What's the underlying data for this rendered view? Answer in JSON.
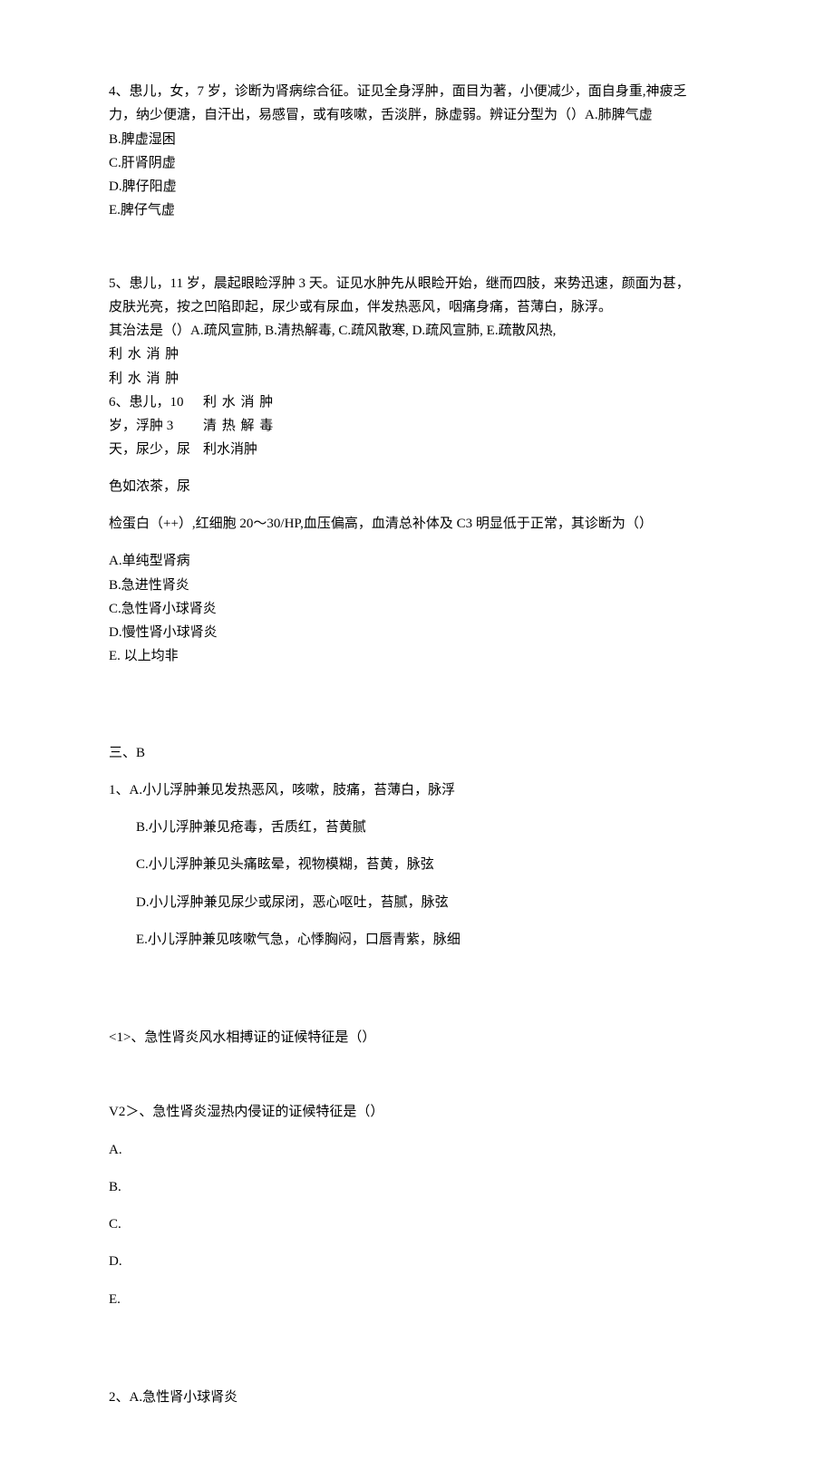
{
  "q4": {
    "stem_line1": "4、患儿，女，7 岁，诊断为肾病综合征。证见全身浮肿，面目为著，小便减少，面自身重,神疲乏",
    "stem_line2": "力，纳少便溏，自汗出，易感冒，或有咳嗽，舌淡胖，脉虚弱。辨证分型为（）A.肺脾气虚",
    "optB": "B.脾虚湿困",
    "optC": "C.肝肾阴虚",
    "optD": "D.脾仔阳虚",
    "optE": "E.脾仔气虚"
  },
  "q5": {
    "stem_line1": "5、患儿，11 岁，晨起眼睑浮肿 3 天。证见水肿先从眼睑开始，继而四肢，来势迅速，颜面为甚，",
    "stem_line2": "皮肤光亮，按之凹陷即起，尿少或有尿血，伴发热恶风，咽痛身痛，苔薄白，脉浮。",
    "stem_line3": "其治法是（）A.疏风宣肺, B.清热解毒, C.疏风散寒, D.疏风宣肺, E.疏散风热,",
    "mid1": "利 水 消 肿",
    "mid2": "利 水 消 肿"
  },
  "q6": {
    "left1": "6、患儿，10",
    "right1": "利 水 消 肿",
    "left2": "岁，浮肿 3",
    "right2": "清 热 解 毒",
    "left3": "天，尿少，尿",
    "right3": "利水消肿",
    "line4": "色如浓茶，尿",
    "line5": "检蛋白（++）,红细胞 20～30/HP,血压偏高，血清总补体及 C3 明显低于正常，其诊断为（）",
    "optA": "A.单纯型肾病",
    "optB": "B.急进性肾炎",
    "optC": "C.急性肾小球肾炎",
    "optD": "D.慢性肾小球肾炎",
    "optE": "E. 以上均非"
  },
  "sectionB": {
    "head": "三、B",
    "q1A": "1、A.小儿浮肿兼见发热恶风，咳嗽，肢痛，苔薄白，脉浮",
    "q1B": "B.小儿浮肿兼见疮毒，舌质红，苔黄腻",
    "q1C": "C.小儿浮肿兼见头痛眩晕，视物模糊，苔黄，脉弦",
    "q1D": "D.小儿浮肿兼见尿少或尿闭，恶心呕吐，苔腻，脉弦",
    "q1E": "E.小儿浮肿兼见咳嗽气急，心悸胸闷，口唇青紫，脉细",
    "sub1": "<1>、急性肾炎风水相搏证的证候特征是（）",
    "sub2": "V2＞、急性肾炎湿热内侵证的证候特征是（）",
    "sub2A": "A.",
    "sub2B": "B.",
    "sub2C": "C.",
    "sub2D": "D.",
    "sub2E": "E.",
    "q2A": "2、A.急性肾小球肾炎"
  }
}
